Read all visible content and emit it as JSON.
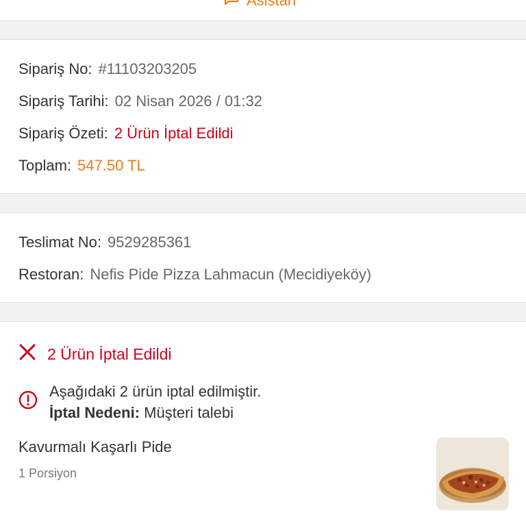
{
  "header": {
    "assistant_label": "Asistan"
  },
  "order": {
    "no_label": "Sipariş No:",
    "no_value": "#11103203205",
    "date_label": "Sipariş Tarihi:",
    "date_value": "02 Nisan 2026 / 01:32",
    "summary_label": "Sipariş Özeti:",
    "summary_value": "2 Ürün İptal Edildi",
    "total_label": "Toplam:",
    "total_value": "547.50 TL"
  },
  "delivery": {
    "no_label": "Teslimat No:",
    "no_value": "9529285361",
    "restaurant_label": "Restoran:",
    "restaurant_value": "Nefis Pide Pizza Lahmacun (Mecidiyeköy)"
  },
  "cancellation": {
    "title": "2 Ürün İptal Edildi",
    "notice_line1": "Aşağıdaki 2 ürün iptal edilmiştir.",
    "reason_label": "İptal Nedeni:",
    "reason_value": "Müşteri talebi"
  },
  "products": [
    {
      "name": "Kavurmalı Kaşarlı Pide",
      "quantity": "1 Porsiyon"
    }
  ],
  "colors": {
    "accent_orange": "#f27a1a",
    "cancel_red": "#d0021b",
    "divider_gray": "#f2f2f2"
  },
  "icons": {
    "assistant": "chat-bubble-icon",
    "cancel": "close-x-icon",
    "notice": "info-circle-icon"
  }
}
